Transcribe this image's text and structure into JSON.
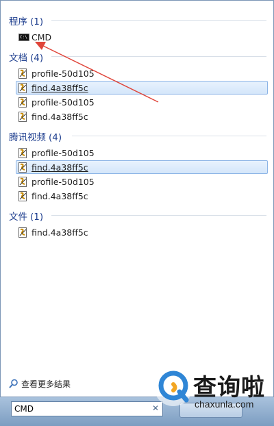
{
  "groups": [
    {
      "title": "程序",
      "count": "(1)",
      "items": [
        {
          "label": "CMD",
          "icon": "cmd-icon",
          "selected": false
        }
      ]
    },
    {
      "title": "文档",
      "count": "(4)",
      "items": [
        {
          "label": "profile-50d105",
          "icon": "script-file-icon",
          "selected": false
        },
        {
          "label": "find.4a38ff5c",
          "icon": "script-file-icon",
          "selected": true
        },
        {
          "label": "profile-50d105",
          "icon": "script-file-icon",
          "selected": false
        },
        {
          "label": "find.4a38ff5c",
          "icon": "script-file-icon",
          "selected": false
        }
      ]
    },
    {
      "title": "腾讯视频",
      "count": "(4)",
      "items": [
        {
          "label": "profile-50d105",
          "icon": "script-file-icon",
          "selected": false
        },
        {
          "label": "find.4a38ff5c",
          "icon": "script-file-icon",
          "selected": true
        },
        {
          "label": "profile-50d105",
          "icon": "script-file-icon",
          "selected": false
        },
        {
          "label": "find.4a38ff5c",
          "icon": "script-file-icon",
          "selected": false
        }
      ]
    },
    {
      "title": "文件",
      "count": "(1)",
      "items": [
        {
          "label": "find.4a38ff5c",
          "icon": "script-file-icon",
          "selected": false
        }
      ]
    }
  ],
  "see_more": {
    "label": "查看更多结果",
    "icon": "search-icon"
  },
  "search": {
    "value": "CMD",
    "clear_icon": "close-icon"
  },
  "watermark": {
    "cn": "查询啦",
    "en": "chaxunla.com"
  },
  "colors": {
    "group_title": "#1f3f8f",
    "arrow": "#e0453a",
    "accent": "#2f86d6"
  }
}
